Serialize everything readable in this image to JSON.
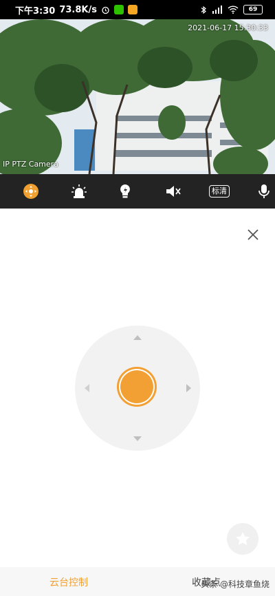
{
  "status_bar": {
    "time": "下午3:30",
    "speed": "73.8K/s",
    "battery": "69"
  },
  "camera": {
    "timestamp": "2021-06-17 15:30:33",
    "label": "IP PTZ Camera"
  },
  "toolbar": {
    "quality_label": "标清",
    "icons": [
      "ptz-icon",
      "alarm-icon",
      "light-icon",
      "mute-icon",
      "quality-badge",
      "mic-icon"
    ],
    "accent": "#f0a030"
  },
  "panel": {
    "close_icon": "close-icon",
    "favorite_icon": "star-icon",
    "joystick_color": "#f2a033"
  },
  "bottom_tabs": {
    "ptz": "云台控制",
    "favorites": "收藏点"
  },
  "watermark": "头条 @科技章鱼烧"
}
